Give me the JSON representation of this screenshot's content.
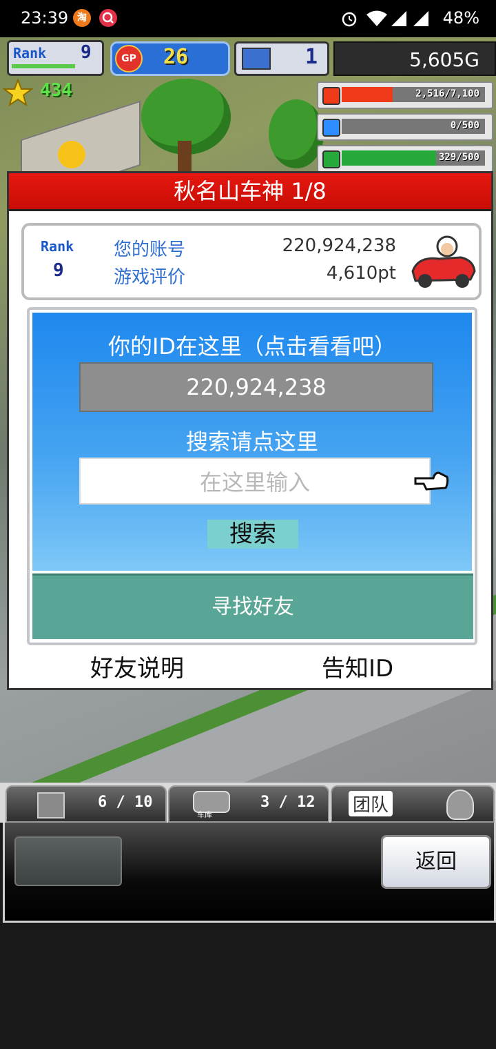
{
  "status_bar": {
    "time": "23:39",
    "notification_1": "淘",
    "battery": "48%"
  },
  "hud": {
    "rank_label": "Rank",
    "rank_value": "9",
    "gp_label": "GP",
    "gp_value": "26",
    "pc_value": "1",
    "money": "5,605G",
    "stars": "434",
    "bars": [
      {
        "icon": "coin-icon",
        "text": "2,516/7,100",
        "color": "#ef3b1a",
        "fill_fraction": 0.354
      },
      {
        "icon": "fuel-icon",
        "text": "0/500",
        "color": "#2d8cff",
        "fill_fraction": 0.0
      },
      {
        "icon": "wheat-icon",
        "text": "329/500",
        "color": "#27a83b",
        "fill_fraction": 0.658
      }
    ]
  },
  "dialog": {
    "title": "秋名山车神 1/8",
    "rank_label": "Rank",
    "rank_value": "9",
    "account_label": "您的账号",
    "account_value": "220,924,238",
    "rating_label": "游戏评价",
    "rating_value": "4,610pt",
    "id_hint": "你的ID在这里（点击看看吧）",
    "id_value": "220,924,238",
    "search_hint": "搜索请点这里",
    "search_placeholder": "在这里输入",
    "search_button": "搜索",
    "find_friends": "寻找好友",
    "friend_help": "好友说明",
    "notify_id": "告知ID"
  },
  "bottom": {
    "tab1_count": "6 / 10",
    "tab2_label": "车库",
    "tab2_count": "3 / 12",
    "tab3_label": "团队",
    "back_button": "返回"
  }
}
